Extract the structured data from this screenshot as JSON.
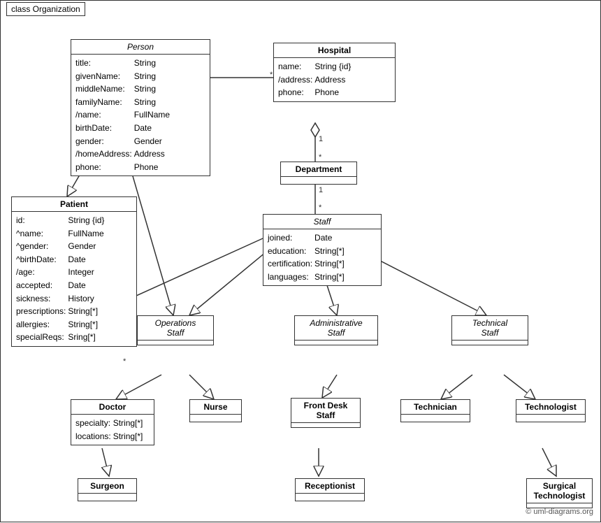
{
  "diagram": {
    "title": "class Organization",
    "classes": {
      "person": {
        "name": "Person",
        "italic": true,
        "attributes": [
          [
            "title:",
            "String"
          ],
          [
            "givenName:",
            "String"
          ],
          [
            "middleName:",
            "String"
          ],
          [
            "familyName:",
            "String"
          ],
          [
            "/name:",
            "FullName"
          ],
          [
            "birthDate:",
            "Date"
          ],
          [
            "gender:",
            "Gender"
          ],
          [
            "/homeAddress:",
            "Address"
          ],
          [
            "phone:",
            "Phone"
          ]
        ]
      },
      "hospital": {
        "name": "Hospital",
        "attributes": [
          [
            "name:",
            "String {id}"
          ],
          [
            "/address:",
            "Address"
          ],
          [
            "phone:",
            "Phone"
          ]
        ]
      },
      "department": {
        "name": "Department",
        "attributes": []
      },
      "staff": {
        "name": "Staff",
        "italic": true,
        "attributes": [
          [
            "joined:",
            "Date"
          ],
          [
            "education:",
            "String[*]"
          ],
          [
            "certification:",
            "String[*]"
          ],
          [
            "languages:",
            "String[*]"
          ]
        ]
      },
      "patient": {
        "name": "Patient",
        "attributes": [
          [
            "id:",
            "String {id}"
          ],
          [
            "^name:",
            "FullName"
          ],
          [
            "^gender:",
            "Gender"
          ],
          [
            "^birthDate:",
            "Date"
          ],
          [
            "/age:",
            "Integer"
          ],
          [
            "accepted:",
            "Date"
          ],
          [
            "sickness:",
            "History"
          ],
          [
            "prescriptions:",
            "String[*]"
          ],
          [
            "allergies:",
            "String[*]"
          ],
          [
            "specialReqs:",
            "Sring[*]"
          ]
        ]
      },
      "operations_staff": {
        "name": "Operations Staff",
        "italic": true
      },
      "administrative_staff": {
        "name": "Administrative Staff",
        "italic": true
      },
      "technical_staff": {
        "name": "Technical Staff",
        "italic": true
      },
      "doctor": {
        "name": "Doctor",
        "attributes": [
          [
            "specialty:",
            "String[*]"
          ],
          [
            "locations:",
            "String[*]"
          ]
        ]
      },
      "nurse": {
        "name": "Nurse",
        "attributes": []
      },
      "front_desk_staff": {
        "name": "Front Desk Staff",
        "attributes": []
      },
      "technician": {
        "name": "Technician",
        "attributes": []
      },
      "technologist": {
        "name": "Technologist",
        "attributes": []
      },
      "surgeon": {
        "name": "Surgeon",
        "attributes": []
      },
      "receptionist": {
        "name": "Receptionist",
        "attributes": []
      },
      "surgical_technologist": {
        "name": "Surgical Technologist",
        "attributes": []
      }
    },
    "copyright": "© uml-diagrams.org"
  }
}
